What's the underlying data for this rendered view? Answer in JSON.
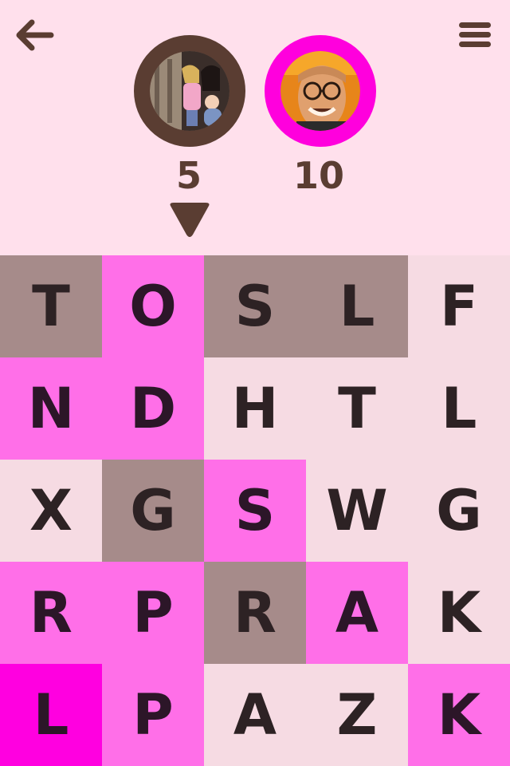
{
  "header": {
    "back_icon": "arrow-left-icon",
    "menu_icon": "hamburger-menu-icon"
  },
  "players": [
    {
      "score": "5",
      "color": "#5a3d32",
      "active": true
    },
    {
      "score": "10",
      "color": "#ff00dd",
      "active": false
    }
  ],
  "colors": {
    "background": "#ffe0ec",
    "neutral": "#f6dbe3",
    "p1": "#a68b8a",
    "p2": "#ff6fe8",
    "p2_locked": "#ff00e0",
    "text": "#2d2224",
    "icon": "#5a3d32"
  },
  "board": {
    "rows": [
      [
        {
          "letter": "T",
          "state": "p1"
        },
        {
          "letter": "O",
          "state": "p2"
        },
        {
          "letter": "S",
          "state": "p1"
        },
        {
          "letter": "L",
          "state": "p1"
        },
        {
          "letter": "F",
          "state": "neutral"
        }
      ],
      [
        {
          "letter": "N",
          "state": "p2"
        },
        {
          "letter": "D",
          "state": "p2"
        },
        {
          "letter": "H",
          "state": "neutral"
        },
        {
          "letter": "T",
          "state": "neutral"
        },
        {
          "letter": "L",
          "state": "neutral"
        }
      ],
      [
        {
          "letter": "X",
          "state": "neutral"
        },
        {
          "letter": "G",
          "state": "p1"
        },
        {
          "letter": "S",
          "state": "p2"
        },
        {
          "letter": "W",
          "state": "neutral"
        },
        {
          "letter": "G",
          "state": "neutral"
        }
      ],
      [
        {
          "letter": "R",
          "state": "p2"
        },
        {
          "letter": "P",
          "state": "p2"
        },
        {
          "letter": "R",
          "state": "p1"
        },
        {
          "letter": "A",
          "state": "p2"
        },
        {
          "letter": "K",
          "state": "neutral"
        }
      ],
      [
        {
          "letter": "L",
          "state": "p2-locked"
        },
        {
          "letter": "P",
          "state": "p2"
        },
        {
          "letter": "A",
          "state": "neutral"
        },
        {
          "letter": "Z",
          "state": "neutral"
        },
        {
          "letter": "K",
          "state": "p2"
        }
      ]
    ]
  }
}
